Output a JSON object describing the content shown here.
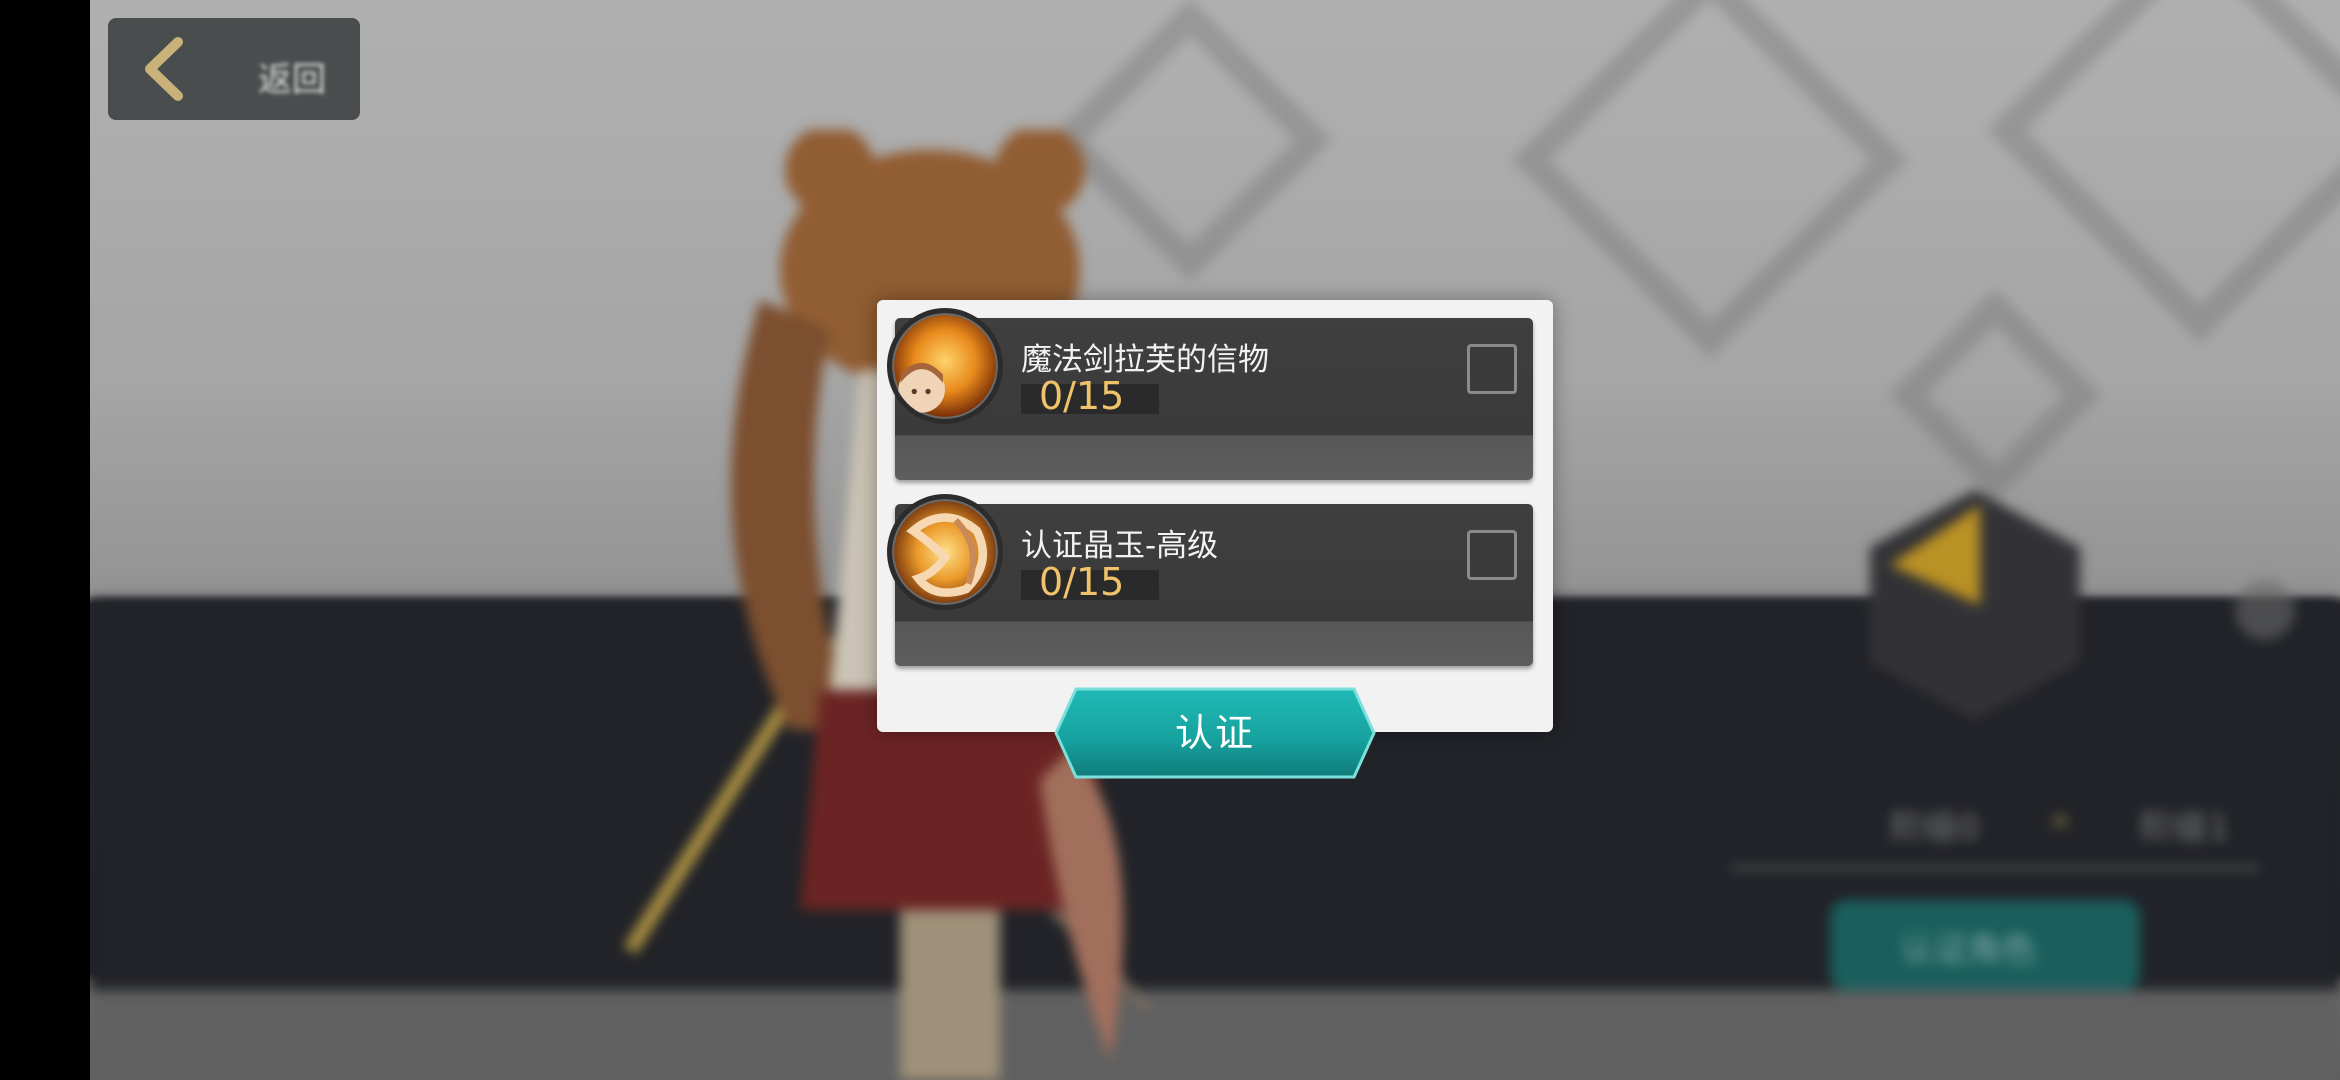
{
  "header": {
    "back_icon": "chevron-left-icon",
    "back_label": "返回"
  },
  "dialog": {
    "items": [
      {
        "name": "魔法剑拉芙的信物",
        "count": "0/15",
        "icon": "character-token-icon",
        "checked": false
      },
      {
        "name": "认证晶玉-高级",
        "count": "0/15",
        "icon": "advanced-crystal-icon",
        "checked": false
      }
    ],
    "confirm_label": "认证"
  },
  "background": {
    "stage_from": "阶级0",
    "stage_arrow": "»",
    "stage_to": "阶级1",
    "certify_character_label": "认证角色"
  },
  "colors": {
    "count_color": "#f0c36a",
    "button_teal": "#1aa9a6",
    "accent_gold": "#d4a52a"
  }
}
